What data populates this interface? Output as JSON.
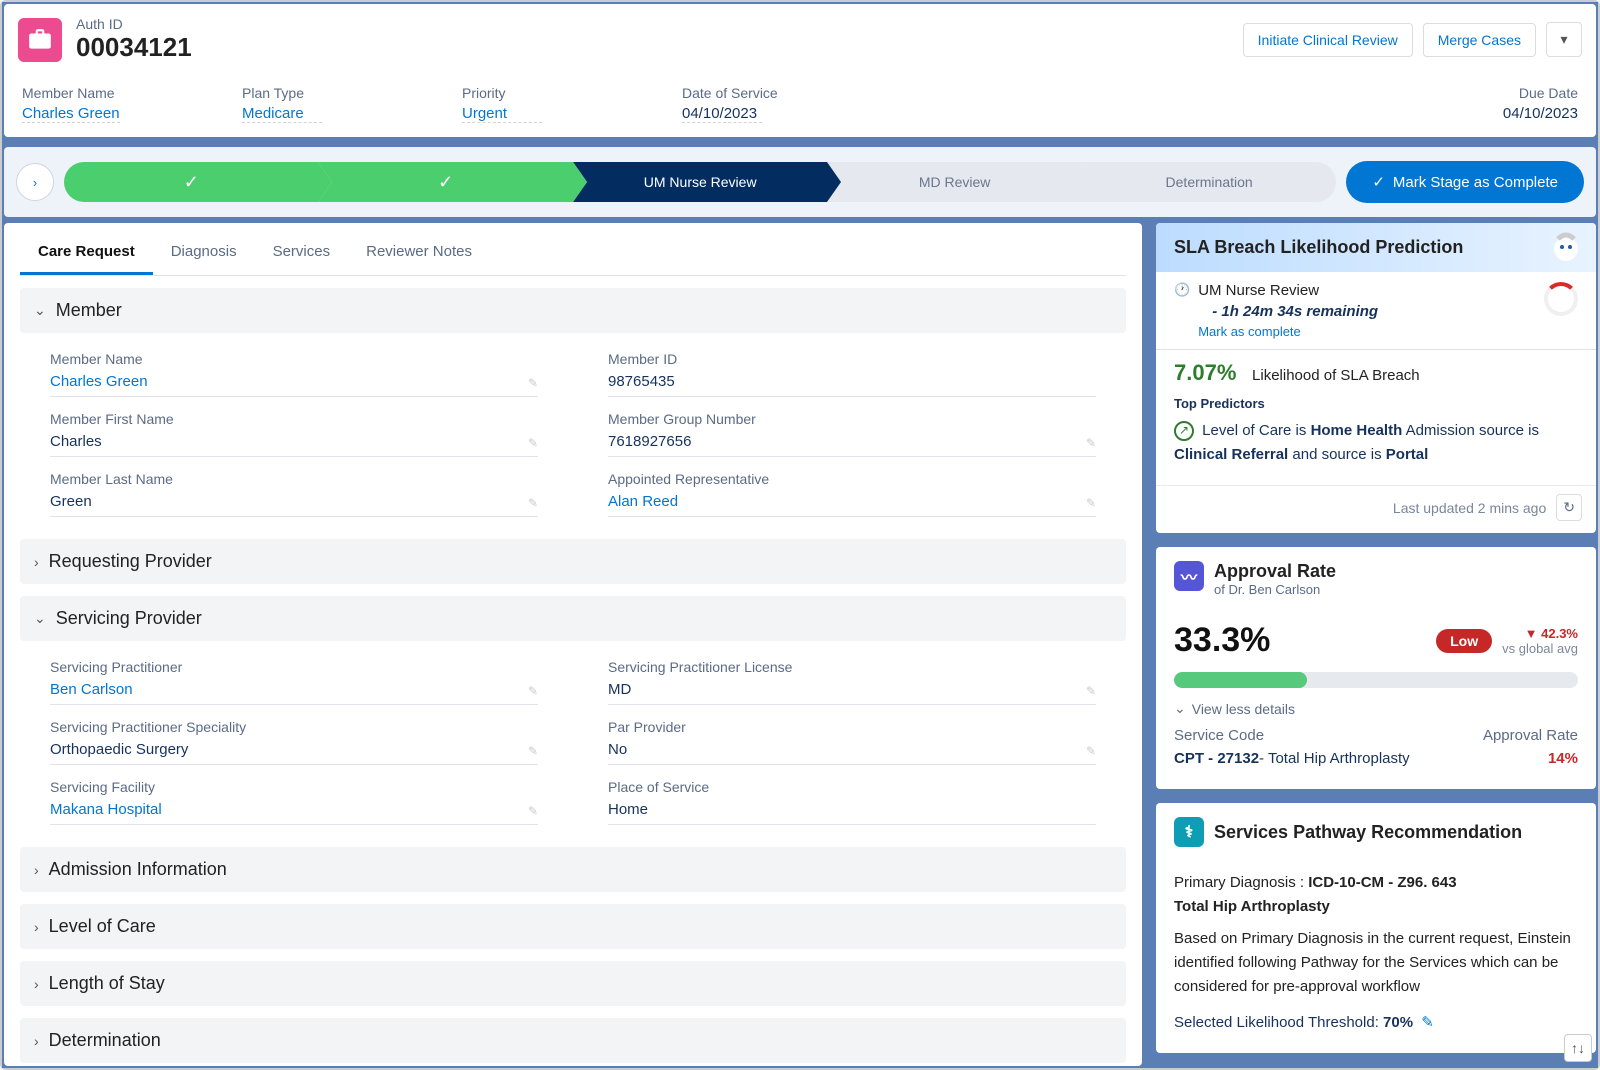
{
  "header": {
    "subtitle": "Auth ID",
    "title": "00034121",
    "actions": {
      "initiate": "Initiate Clinical Review",
      "merge": "Merge Cases"
    },
    "fields": {
      "memberName": {
        "label": "Member Name",
        "value": "Charles Green"
      },
      "planType": {
        "label": "Plan Type",
        "value": "Medicare"
      },
      "priority": {
        "label": "Priority",
        "value": "Urgent"
      },
      "dos": {
        "label": "Date of Service",
        "value": "04/10/2023"
      },
      "due": {
        "label": "Due Date",
        "value": "04/10/2023"
      }
    }
  },
  "stages": {
    "s3": "UM Nurse Review",
    "s4": "MD Review",
    "s5": "Determination",
    "markBtn": "Mark Stage as Complete"
  },
  "tabs": {
    "t1": "Care Request",
    "t2": "Diagnosis",
    "t3": "Services",
    "t4": "Reviewer Notes"
  },
  "sections": {
    "member": {
      "title": "Member",
      "f": {
        "memberName": {
          "l": "Member Name",
          "v": "Charles Green"
        },
        "memberId": {
          "l": "Member ID",
          "v": "98765435"
        },
        "firstName": {
          "l": "Member First Name",
          "v": "Charles"
        },
        "groupNum": {
          "l": "Member Group Number",
          "v": "7618927656"
        },
        "lastName": {
          "l": "Member Last Name",
          "v": "Green"
        },
        "rep": {
          "l": "Appointed Representative",
          "v": "Alan Reed"
        }
      }
    },
    "requesting": {
      "title": "Requesting Provider"
    },
    "servicing": {
      "title": "Servicing Provider",
      "f": {
        "practitioner": {
          "l": "Servicing Practitioner",
          "v": "Ben Carlson"
        },
        "license": {
          "l": "Servicing Practitioner License",
          "v": "MD"
        },
        "speciality": {
          "l": "Servicing Practitioner Speciality",
          "v": "Orthopaedic Surgery"
        },
        "par": {
          "l": "Par Provider",
          "v": "No"
        },
        "facility": {
          "l": "Servicing Facility",
          "v": "Makana Hospital"
        },
        "pos": {
          "l": "Place of Service",
          "v": "Home"
        }
      }
    },
    "admission": {
      "title": "Admission Information"
    },
    "loc": {
      "title": "Level of Care"
    },
    "los": {
      "title": "Length of Stay"
    },
    "det": {
      "title": "Determination"
    }
  },
  "sla": {
    "title": "SLA Breach Likelihood Prediction",
    "stage": "UM Nurse Review",
    "remaining": "- 1h 24m 34s remaining",
    "markLink": "Mark as complete",
    "pct": "7.07%",
    "pctLabel": "Likelihood of SLA Breach",
    "topPred": "Top Predictors",
    "predPrefix": "Level of Care is ",
    "predB1": "Home Health",
    "predMid1": " Admission source is ",
    "predB2": "Clinical Referral",
    "predMid2": " and source is ",
    "predB3": "Portal",
    "updated": "Last updated 2 mins ago"
  },
  "approval": {
    "title": "Approval Rate",
    "subtitle": "of Dr. Ben Carlson",
    "pct": "33.3%",
    "pill": "Low",
    "delta": "▼ 42.3%",
    "deltaSub": "vs global avg",
    "viewLess": "View less details",
    "svcCodeH": "Service Code",
    "svcCode1": "CPT - 27132",
    "svcCode1suffix": "- Total Hip Arthroplasty",
    "rateH": "Approval Rate",
    "rateV": "14%"
  },
  "pathway": {
    "title": "Services Pathway Recommendation",
    "diagLabel": "Primary Diagnosis : ",
    "diagCode": "ICD-10-CM - Z96. 643",
    "diagName": "Total Hip Arthroplasty",
    "desc": "Based on Primary Diagnosis in the current request, Einstein identified following Pathway for the Services which can be considered for pre-approval workflow",
    "thresholdLabel": "Selected Likelihood Threshold: ",
    "thresholdVal": "70%"
  }
}
